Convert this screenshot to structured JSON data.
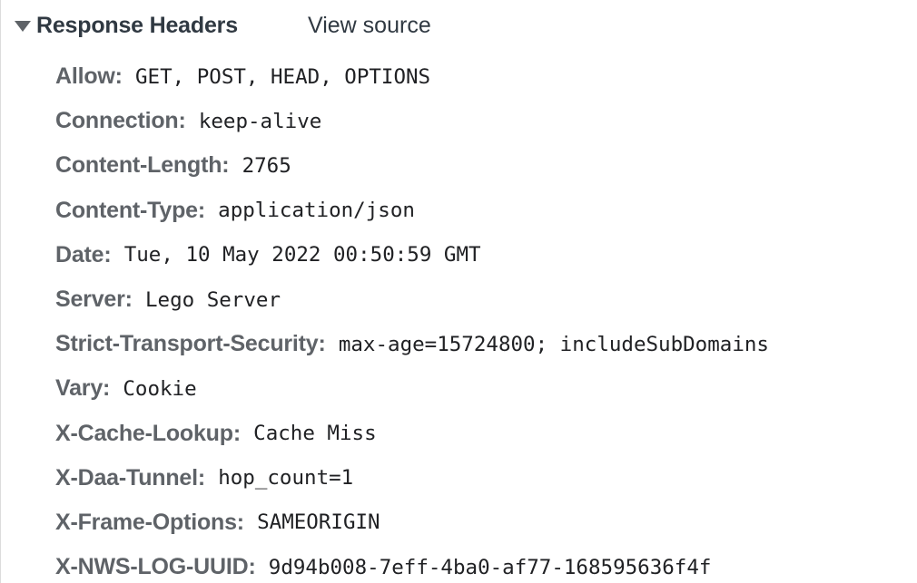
{
  "section": {
    "title": "Response Headers",
    "view_source_label": "View source",
    "expanded": true,
    "toggle_icon": "triangle-down-icon"
  },
  "headers": [
    {
      "name": "Allow",
      "value": "GET, POST, HEAD, OPTIONS"
    },
    {
      "name": "Connection",
      "value": "keep-alive"
    },
    {
      "name": "Content-Length",
      "value": "2765"
    },
    {
      "name": "Content-Type",
      "value": "application/json"
    },
    {
      "name": "Date",
      "value": "Tue, 10 May 2022 00:50:59 GMT"
    },
    {
      "name": "Server",
      "value": "Lego Server"
    },
    {
      "name": "Strict-Transport-Security",
      "value": "max-age=15724800; includeSubDomains"
    },
    {
      "name": "Vary",
      "value": "Cookie"
    },
    {
      "name": "X-Cache-Lookup",
      "value": "Cache Miss"
    },
    {
      "name": "X-Daa-Tunnel",
      "value": "hop_count=1"
    },
    {
      "name": "X-Frame-Options",
      "value": "SAMEORIGIN"
    },
    {
      "name": "X-NWS-LOG-UUID",
      "value": "9d94b008-7eff-4ba0-af77-168595636f4f"
    }
  ]
}
